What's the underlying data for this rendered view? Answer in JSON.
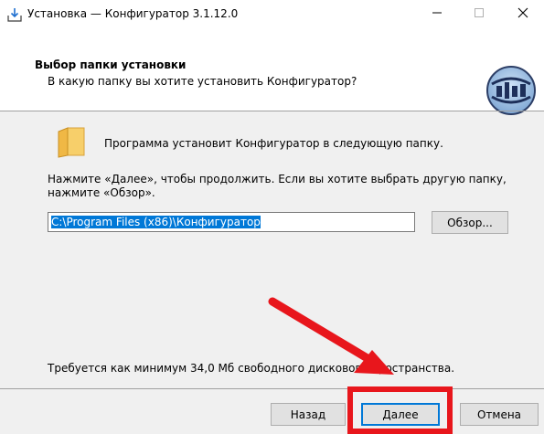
{
  "window": {
    "title": "Установка — Конфигуратор 3.1.12.0",
    "controls": {
      "minimize_icon": "minimize-icon",
      "maximize_icon": "maximize-icon",
      "close_icon": "close-icon"
    }
  },
  "header": {
    "title": "Выбор папки установки",
    "subtitle": "В какую папку вы хотите установить Конфигуратор?"
  },
  "main": {
    "intro": "Программа установит Конфигуратор в следующую папку.",
    "instruction": "Нажмите «Далее», чтобы продолжить. Если вы хотите выбрать другую папку, нажмите «Обзор».",
    "path_value": "C:\\Program Files (x86)\\Конфигуратор",
    "browse_label": "Обзор...",
    "space_required": "Требуется как минимум 34,0 Мб свободного дискового пространства."
  },
  "footer": {
    "back_label": "Назад",
    "next_label": "Далее",
    "cancel_label": "Отмена"
  },
  "colors": {
    "accent": "#0078d7",
    "annotation": "#e8161c"
  }
}
